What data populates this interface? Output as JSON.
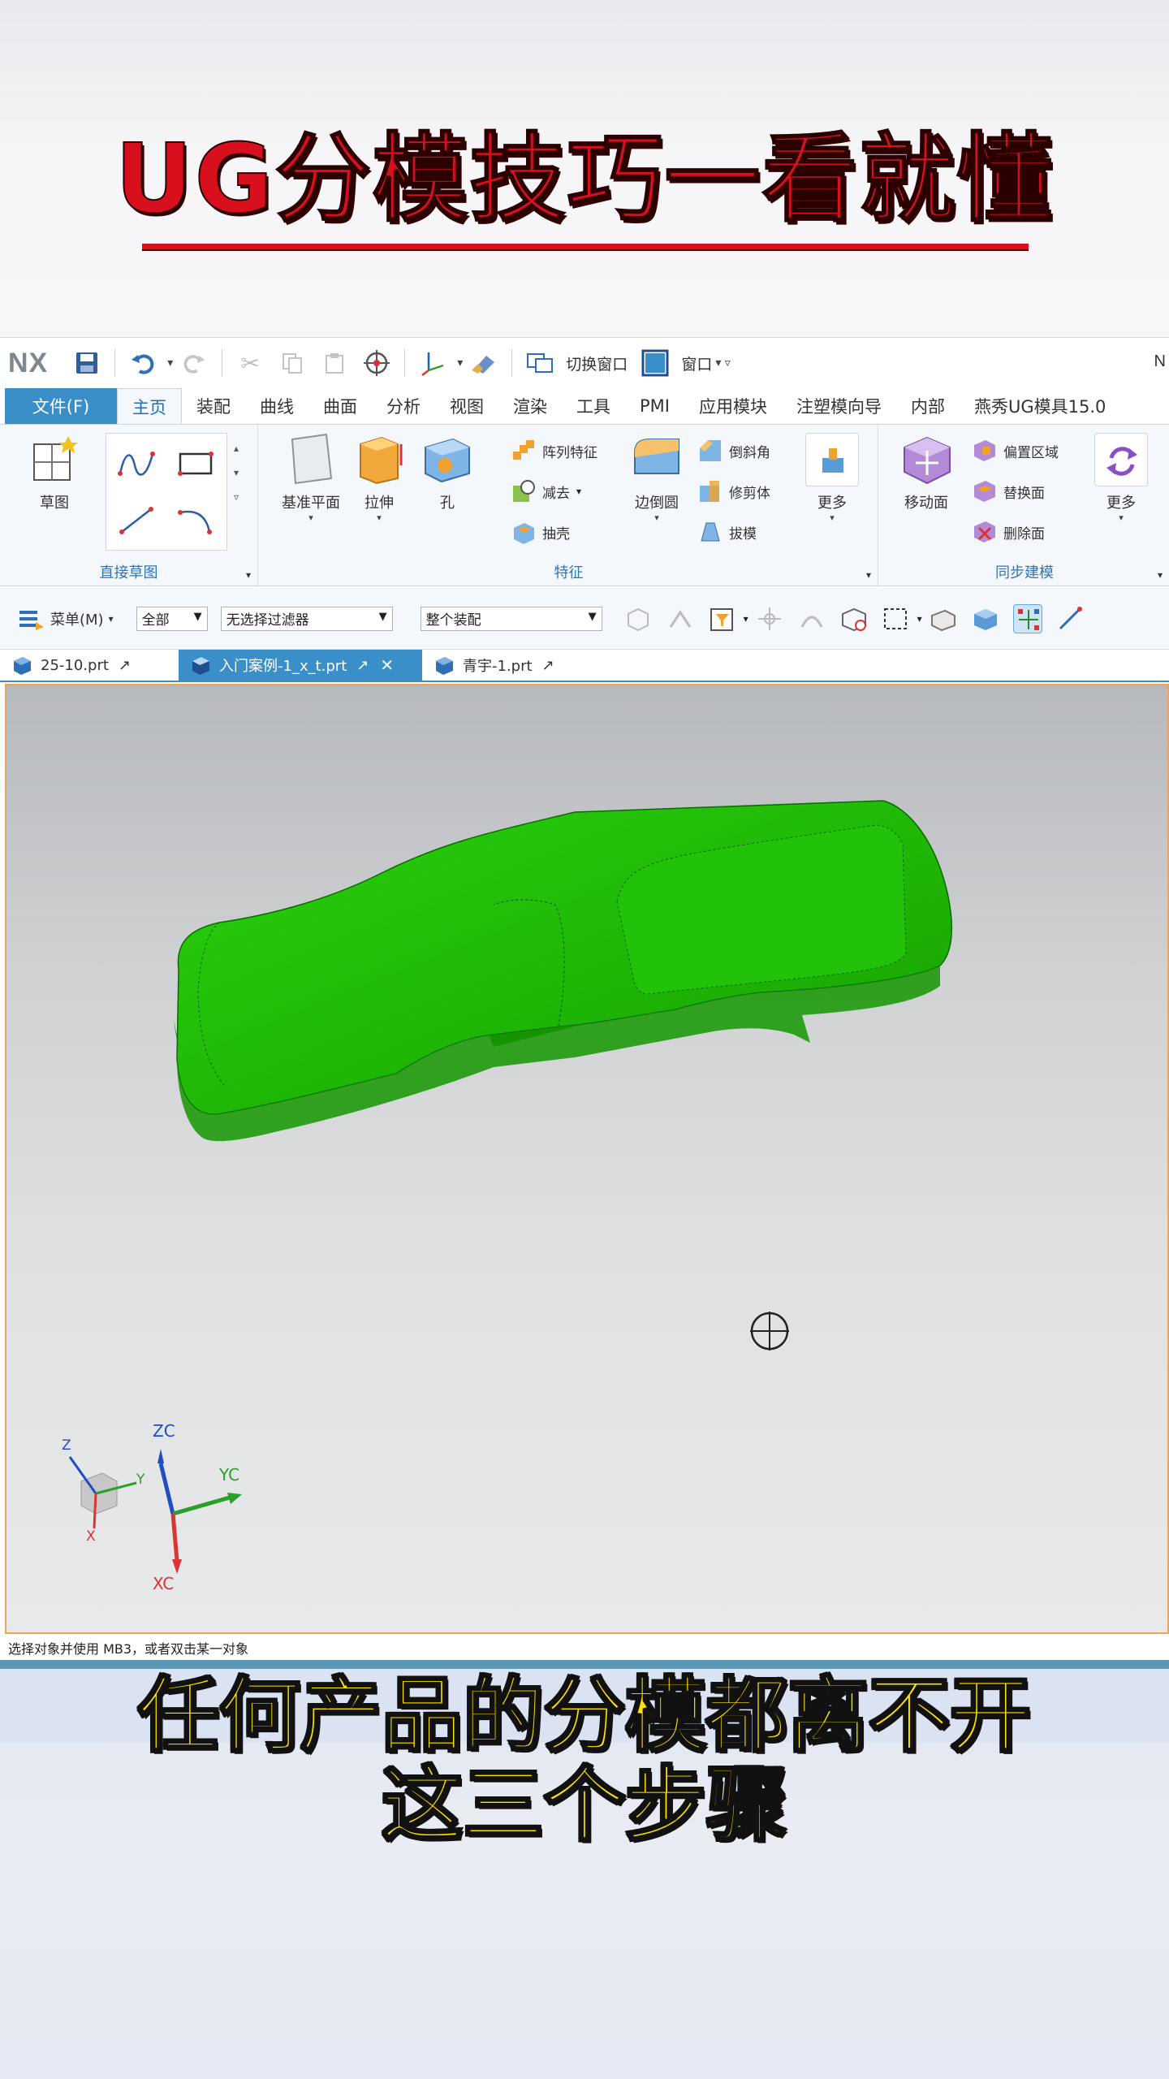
{
  "headline": "UG分模技巧一看就懂",
  "app": {
    "logo": "NX",
    "qat": {
      "switch_window": "切换窗口",
      "window": "窗口",
      "right_letter": "N"
    },
    "tabs": [
      "文件(F)",
      "主页",
      "装配",
      "曲线",
      "曲面",
      "分析",
      "视图",
      "渲染",
      "工具",
      "PMI",
      "应用模块",
      "注塑模向导",
      "内部",
      "燕秀UG模具15.0"
    ],
    "active_tab": "主页",
    "ribbon": {
      "direct_sketch": {
        "group_label": "直接草图",
        "sketch_label": "草图"
      },
      "feature": {
        "group_label": "特征",
        "datum_plane": "基准平面",
        "extrude": "拉伸",
        "hole": "孔",
        "pattern": "阵列特征",
        "subtract": "减去",
        "shell": "抽壳",
        "edge_blend": "边倒圆",
        "chamfer": "倒斜角",
        "trim_body": "修剪体",
        "draft": "拔模",
        "more": "更多"
      },
      "sync": {
        "group_label": "同步建模",
        "move_face": "移动面",
        "offset_region": "偏置区域",
        "replace_face": "替换面",
        "delete_face": "删除面",
        "more": "更多"
      }
    },
    "selection": {
      "menu_label": "菜单(M)",
      "filter_all": "全部",
      "type_filter": "无选择过滤器",
      "scope": "整个装配"
    },
    "doc_tabs": [
      {
        "name": "25-10.prt",
        "active": false
      },
      {
        "name": "入门案例-1_x_t.prt",
        "active": true
      },
      {
        "name": "青宇-1.prt",
        "active": false
      }
    ],
    "triad": {
      "z": "Z",
      "y": "Y",
      "x": "X",
      "zc": "ZC",
      "yc": "YC",
      "xc": "XC"
    },
    "status_text": "选择对象并使用 MB3，或者双击某一对象"
  },
  "caption": {
    "line1": "任何产品的分模都离不开",
    "line2": "这三个步骤"
  },
  "colors": {
    "model": "#1bb600",
    "headline": "#d8101e",
    "caption": "#ffe100",
    "accent": "#3b8fc8"
  }
}
